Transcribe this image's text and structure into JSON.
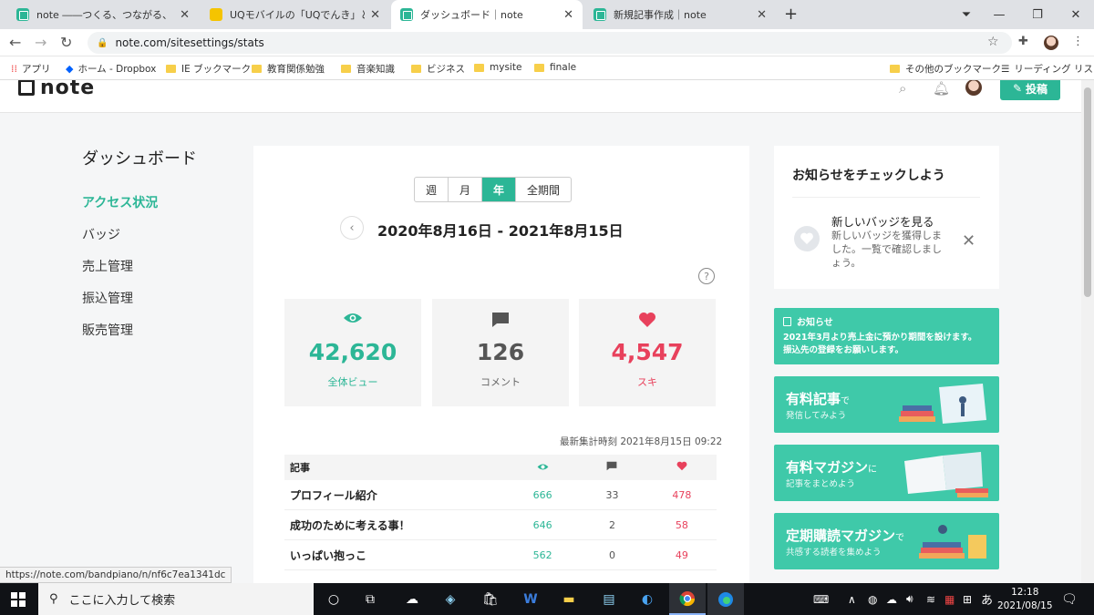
{
  "browser": {
    "tabs": [
      {
        "title": "note ――つくる、つながる、とどける。",
        "icon": "note-favicon"
      },
      {
        "title": "UQモバイルの「UQでんき」と「でんき割」",
        "icon": "uq-favicon"
      },
      {
        "title": "ダッシュボード｜note",
        "icon": "note-favicon",
        "active": true
      },
      {
        "title": "新規記事作成｜note",
        "icon": "note-favicon"
      }
    ],
    "url": "note.com/sitesettings/stats",
    "bookmarks": [
      {
        "label": "アプリ",
        "icon": "apps-grid-icon"
      },
      {
        "label": "ホーム - Dropbox",
        "icon": "dropbox-icon"
      },
      {
        "label": "IE ブックマーク",
        "icon": "folder-icon"
      },
      {
        "label": "教育関係勉強",
        "icon": "folder-icon"
      },
      {
        "label": "音楽知識",
        "icon": "folder-icon"
      },
      {
        "label": "ビジネス",
        "icon": "folder-icon"
      },
      {
        "label": "mysite",
        "icon": "folder-icon"
      },
      {
        "label": "finale",
        "icon": "folder-icon"
      }
    ],
    "bookmarks_right": [
      {
        "label": "その他のブックマーク",
        "icon": "folder-icon"
      },
      {
        "label": "リーディング リスト",
        "icon": "reading-list-icon"
      }
    ],
    "status_url": "https://note.com/bandpiano/n/nf6c7ea1341dc"
  },
  "header": {
    "logo": "note",
    "post_button": "投稿"
  },
  "sidebar": {
    "title": "ダッシュボード",
    "items": [
      {
        "label": "アクセス状況",
        "active": true
      },
      {
        "label": "バッジ"
      },
      {
        "label": "売上管理"
      },
      {
        "label": "振込管理"
      },
      {
        "label": "販売管理"
      }
    ]
  },
  "stats": {
    "periods": [
      "週",
      "月",
      "年",
      "全期間"
    ],
    "selected_period": "年",
    "date_range": "2020年8月16日 - 2021年8月15日",
    "cards": [
      {
        "value": "42,620",
        "label": "全体ビュー",
        "icon": "eye-icon",
        "color": "#2cb696"
      },
      {
        "value": "126",
        "label": "コメント",
        "icon": "comment-icon",
        "color": "#555555"
      },
      {
        "value": "4,547",
        "label": "スキ",
        "icon": "heart-icon",
        "color": "#e8415c"
      }
    ],
    "updated_at": "最新集計時刻 2021年8月15日 09:22",
    "table": {
      "header": "記事",
      "rows": [
        {
          "title": "プロフィール紹介",
          "views": "666",
          "comments": "33",
          "likes": "478"
        },
        {
          "title": "成功のために考える事！",
          "views": "646",
          "comments": "2",
          "likes": "58"
        },
        {
          "title": "いっぱい抱っこ",
          "views": "562",
          "comments": "0",
          "likes": "49"
        }
      ]
    }
  },
  "right": {
    "notice_title": "お知らせをチェックしよう",
    "badge_title": "新しいバッジを見る",
    "badge_desc": "新しいバッジを獲得しました。一覧で確認しましょう。",
    "info_label": "お知らせ",
    "info_body_1": "2021年3月より売上金に預かり期間を設けます。",
    "info_body_2": "振込先の登録をお願いします。",
    "promos": [
      {
        "title": "有料記事",
        "suffix": "で",
        "sub": "発信してみよう"
      },
      {
        "title": "有料マガジン",
        "suffix": "に",
        "sub": "記事をまとめよう"
      },
      {
        "title": "定期購読マガジン",
        "suffix": "で",
        "sub": "共感する読者を集めよう"
      }
    ]
  },
  "taskbar": {
    "search_placeholder": "ここに入力して検索",
    "ime": "あ",
    "time": "12:18",
    "date": "2021/08/15"
  },
  "colors": {
    "accent": "#2cb696",
    "like": "#e8415c",
    "promo": "#3fc9a9"
  }
}
